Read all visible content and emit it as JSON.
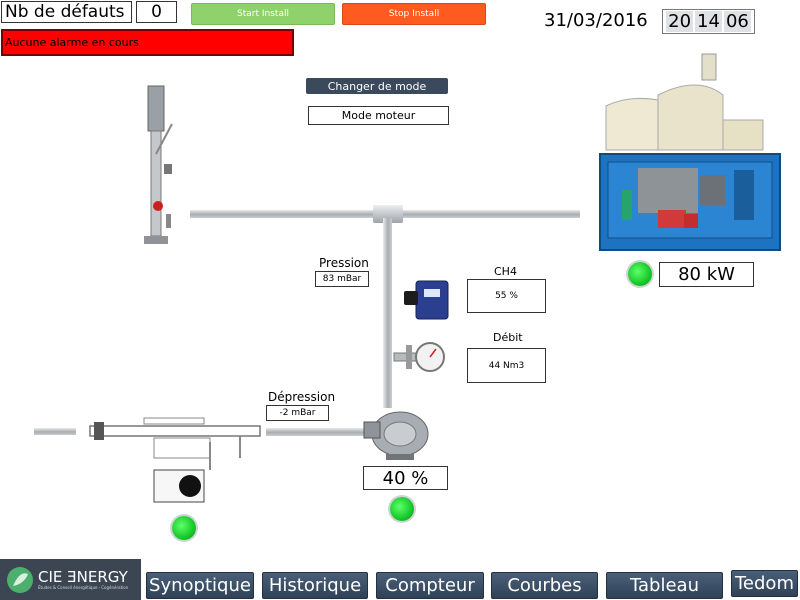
{
  "header": {
    "defects_label": "Nb de défauts",
    "defects_count": "0",
    "start_button": "Start Install",
    "stop_button": "Stop Install",
    "alarm_text": "Aucune alarme en cours",
    "date": "31/03/2016",
    "time_hh": "20",
    "time_mm": "14",
    "time_ss": "06"
  },
  "mode": {
    "change_button": "Changer de mode",
    "current_mode": "Mode moteur"
  },
  "readings": {
    "pressure_label": "Pression",
    "pressure_value": "83 mBar",
    "depression_label": "Dépression",
    "depression_value": "-2 mBar",
    "ch4_label": "CH4",
    "ch4_value": "55 %",
    "flow_label": "Débit",
    "flow_value": "44 Nm3",
    "power_value": "80 kW",
    "blower_value": "40 %"
  },
  "logo": {
    "brand": "CIE ƎNERGY",
    "tagline": "Études & Conseil énergétique · Cogénération"
  },
  "nav": {
    "synoptique": "Synoptique",
    "historique": "Historique",
    "compteur": "Compteur",
    "courbes": "Courbes",
    "tableau": "Tableau",
    "tedom": "Tedom"
  },
  "colors": {
    "alarm_bg": "#ff0000",
    "start_green": "#8fd16a",
    "stop_orange": "#ff5a1f",
    "nav_blue": "#3a4e66",
    "led_green": "#18c82a"
  }
}
